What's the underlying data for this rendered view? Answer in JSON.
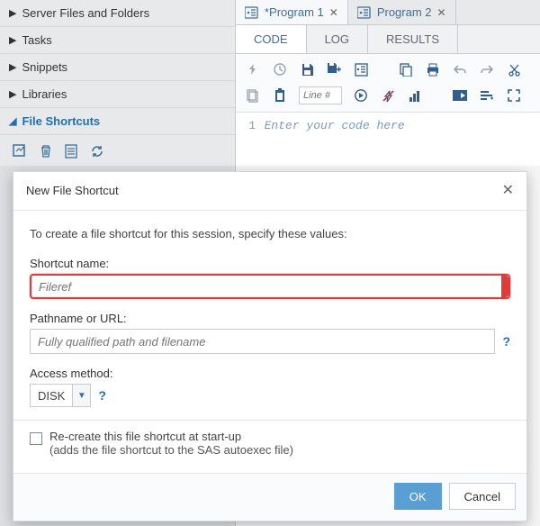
{
  "sidebar": {
    "items": [
      {
        "label": "Server Files and Folders",
        "expanded": false
      },
      {
        "label": "Tasks",
        "expanded": false
      },
      {
        "label": "Snippets",
        "expanded": false
      },
      {
        "label": "Libraries",
        "expanded": false
      },
      {
        "label": "File Shortcuts",
        "expanded": true
      }
    ]
  },
  "tabs": [
    {
      "label": "*Program 1",
      "active": true
    },
    {
      "label": "Program 2",
      "active": false
    }
  ],
  "subtabs": {
    "code": "CODE",
    "log": "LOG",
    "results": "RESULTS"
  },
  "toolbar": {
    "line_placeholder": "Line #"
  },
  "editor": {
    "line_number": "1",
    "placeholder": "Enter your code here"
  },
  "dialog": {
    "title": "New File Shortcut",
    "description": "To create a file shortcut for this session, specify these values:",
    "shortcut_label": "Shortcut name:",
    "shortcut_placeholder": "Fileref",
    "path_label": "Pathname or URL:",
    "path_placeholder": "Fully qualified path and filename",
    "access_label": "Access method:",
    "access_value": "DISK",
    "recreate_label": "Re-create this file shortcut at start-up",
    "recreate_sub": "(adds the file shortcut to the SAS autoexec file)",
    "ok": "OK",
    "cancel": "Cancel"
  }
}
